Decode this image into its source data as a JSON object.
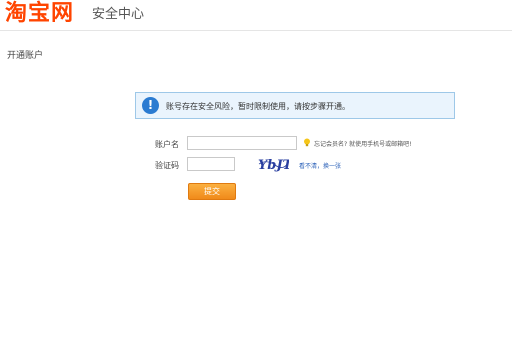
{
  "header": {
    "logo_text": "淘宝网",
    "site_title": "安全中心"
  },
  "page": {
    "title": "开通账户"
  },
  "alert": {
    "icon": "exclamation-icon",
    "message": "账号存在安全风险，暂时限制使用，请按步骤开通。"
  },
  "form": {
    "account_label": "账户名",
    "account_value": "",
    "forgot_hint": "忘记会员名? 就使用手机号或邮箱吧!",
    "captcha_label": "验证码",
    "captcha_value": "",
    "captcha_text": "YbJT",
    "captcha_links": {
      "cant_see": "看不清",
      "separator": "，",
      "refresh": "换一张"
    },
    "submit_label": "提交"
  },
  "colors": {
    "brand": "#ff4400",
    "info_blue": "#2b7bd1",
    "button_orange": "#f39a1f",
    "link_blue": "#2a60b8"
  }
}
